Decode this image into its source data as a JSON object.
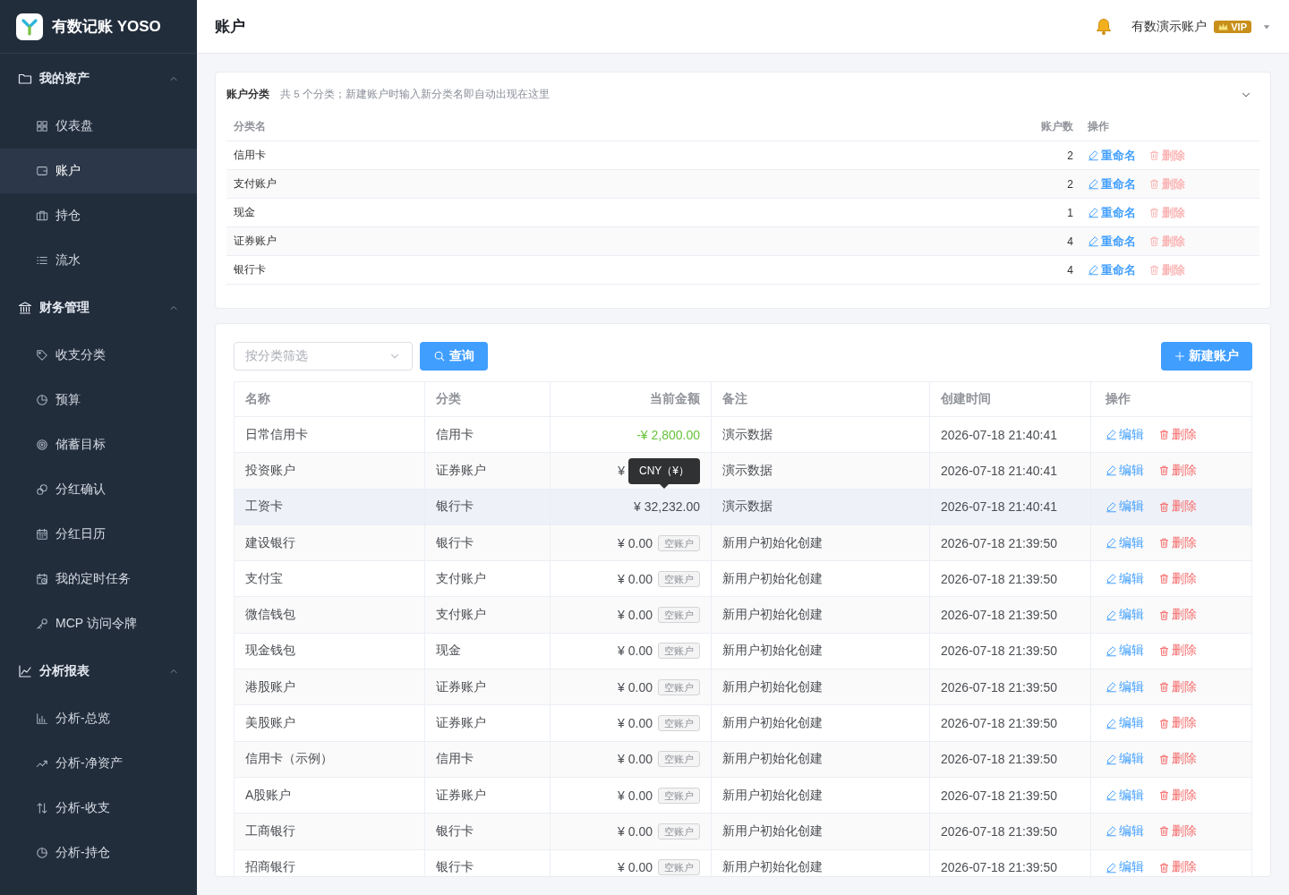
{
  "app": {
    "name": "有数记账 YOSO"
  },
  "sidebar": {
    "groups": [
      {
        "label": "我的资产",
        "expanded": true,
        "items": [
          {
            "label": "仪表盘",
            "selected": false
          },
          {
            "label": "账户",
            "selected": true
          },
          {
            "label": "持仓",
            "selected": false
          },
          {
            "label": "流水",
            "selected": false
          }
        ]
      },
      {
        "label": "财务管理",
        "expanded": true,
        "items": [
          {
            "label": "收支分类",
            "selected": false
          },
          {
            "label": "预算",
            "selected": false
          },
          {
            "label": "储蓄目标",
            "selected": false
          },
          {
            "label": "分红确认",
            "selected": false
          },
          {
            "label": "分红日历",
            "selected": false
          },
          {
            "label": "我的定时任务",
            "selected": false
          },
          {
            "label": "MCP 访问令牌",
            "selected": false
          }
        ]
      },
      {
        "label": "分析报表",
        "expanded": true,
        "items": [
          {
            "label": "分析-总览",
            "selected": false
          },
          {
            "label": "分析-净资产",
            "selected": false
          },
          {
            "label": "分析-收支",
            "selected": false
          },
          {
            "label": "分析-持仓",
            "selected": false
          }
        ]
      }
    ]
  },
  "header": {
    "title": "账户",
    "user": "有数演示账户",
    "badge": "VIP"
  },
  "categories": {
    "title": "账户分类",
    "hint": "共 5 个分类；新建账户时输入新分类名即自动出现在这里",
    "expanded": true,
    "columns": [
      "分类名",
      "账户数",
      "操作"
    ],
    "rows": [
      {
        "name": "信用卡",
        "count": "2",
        "rename": "重命名",
        "delete": "删除",
        "delete_disabled": true
      },
      {
        "name": "支付账户",
        "count": "2",
        "rename": "重命名",
        "delete": "删除",
        "delete_disabled": true
      },
      {
        "name": "现金",
        "count": "1",
        "rename": "重命名",
        "delete": "删除",
        "delete_disabled": true
      },
      {
        "name": "证券账户",
        "count": "4",
        "rename": "重命名",
        "delete": "删除",
        "delete_disabled": true
      },
      {
        "name": "银行卡",
        "count": "4",
        "rename": "重命名",
        "delete": "删除",
        "delete_disabled": true
      }
    ]
  },
  "toolbar": {
    "filter_placeholder": "按分类筛选",
    "query_button": "查询",
    "new_button": "新建账户"
  },
  "accounts": {
    "columns": [
      "名称",
      "分类",
      "当前金额",
      "备注",
      "创建时间",
      "操作"
    ],
    "rows": [
      {
        "name": "日常信用卡",
        "category": "信用卡",
        "amount": "-¥ 2,800.00",
        "negative": true,
        "empty_tag": null,
        "note": "演示数据",
        "created": "2026-07-18 21:40:41",
        "hovered": false,
        "tooltip": null,
        "edit": "编辑",
        "delete": "删除"
      },
      {
        "name": "投资账户",
        "category": "证券账户",
        "amount": "¥",
        "negative": false,
        "empty_tag": null,
        "note": "演示数据",
        "created": "2026-07-18 21:40:41",
        "hovered": false,
        "tooltip": "CNY（¥）",
        "edit": "编辑",
        "delete": "删除"
      },
      {
        "name": "工资卡",
        "category": "银行卡",
        "amount": "¥ 32,232.00",
        "negative": false,
        "empty_tag": null,
        "note": "演示数据",
        "created": "2026-07-18 21:40:41",
        "hovered": true,
        "tooltip": null,
        "edit": "编辑",
        "delete": "删除"
      },
      {
        "name": "建设银行",
        "category": "银行卡",
        "amount": "¥ 0.00",
        "negative": false,
        "empty_tag": "空账户",
        "note": "新用户初始化创建",
        "created": "2026-07-18 21:39:50",
        "hovered": false,
        "tooltip": null,
        "edit": "编辑",
        "delete": "删除"
      },
      {
        "name": "支付宝",
        "category": "支付账户",
        "amount": "¥ 0.00",
        "negative": false,
        "empty_tag": "空账户",
        "note": "新用户初始化创建",
        "created": "2026-07-18 21:39:50",
        "hovered": false,
        "tooltip": null,
        "edit": "编辑",
        "delete": "删除"
      },
      {
        "name": "微信钱包",
        "category": "支付账户",
        "amount": "¥ 0.00",
        "negative": false,
        "empty_tag": "空账户",
        "note": "新用户初始化创建",
        "created": "2026-07-18 21:39:50",
        "hovered": false,
        "tooltip": null,
        "edit": "编辑",
        "delete": "删除"
      },
      {
        "name": "现金钱包",
        "category": "现金",
        "amount": "¥ 0.00",
        "negative": false,
        "empty_tag": "空账户",
        "note": "新用户初始化创建",
        "created": "2026-07-18 21:39:50",
        "hovered": false,
        "tooltip": null,
        "edit": "编辑",
        "delete": "删除"
      },
      {
        "name": "港股账户",
        "category": "证券账户",
        "amount": "¥ 0.00",
        "negative": false,
        "empty_tag": "空账户",
        "note": "新用户初始化创建",
        "created": "2026-07-18 21:39:50",
        "hovered": false,
        "tooltip": null,
        "edit": "编辑",
        "delete": "删除"
      },
      {
        "name": "美股账户",
        "category": "证券账户",
        "amount": "¥ 0.00",
        "negative": false,
        "empty_tag": "空账户",
        "note": "新用户初始化创建",
        "created": "2026-07-18 21:39:50",
        "hovered": false,
        "tooltip": null,
        "edit": "编辑",
        "delete": "删除"
      },
      {
        "name": "信用卡（示例）",
        "category": "信用卡",
        "amount": "¥ 0.00",
        "negative": false,
        "empty_tag": "空账户",
        "note": "新用户初始化创建",
        "created": "2026-07-18 21:39:50",
        "hovered": false,
        "tooltip": null,
        "edit": "编辑",
        "delete": "删除"
      },
      {
        "name": "A股账户",
        "category": "证券账户",
        "amount": "¥ 0.00",
        "negative": false,
        "empty_tag": "空账户",
        "note": "新用户初始化创建",
        "created": "2026-07-18 21:39:50",
        "hovered": false,
        "tooltip": null,
        "edit": "编辑",
        "delete": "删除"
      },
      {
        "name": "工商银行",
        "category": "银行卡",
        "amount": "¥ 0.00",
        "negative": false,
        "empty_tag": "空账户",
        "note": "新用户初始化创建",
        "created": "2026-07-18 21:39:50",
        "hovered": false,
        "tooltip": null,
        "edit": "编辑",
        "delete": "删除"
      },
      {
        "name": "招商银行",
        "category": "银行卡",
        "amount": "¥ 0.00",
        "negative": false,
        "empty_tag": "空账户",
        "note": "新用户初始化创建",
        "created": "2026-07-18 21:39:50",
        "hovered": false,
        "tooltip": null,
        "edit": "编辑",
        "delete": "删除"
      }
    ]
  }
}
